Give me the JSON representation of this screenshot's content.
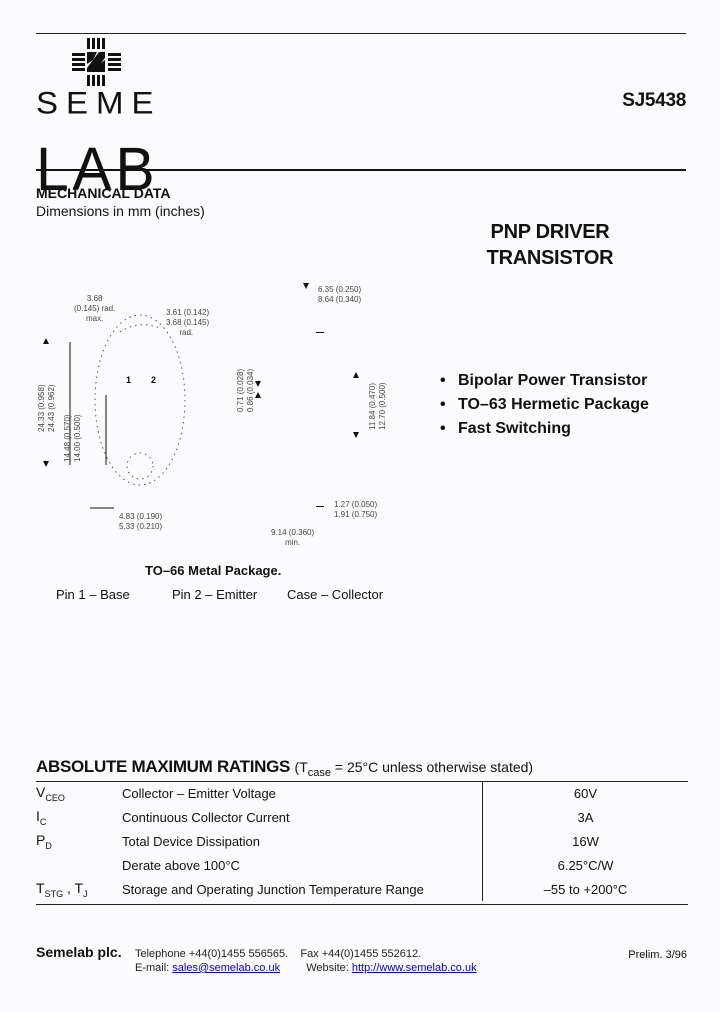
{
  "header": {
    "logo": {
      "top_text": "SEME",
      "bottom_text": "LAB",
      "icon": "semelab-cross-logo-icon"
    },
    "part_number": "SJ5438"
  },
  "mechanical": {
    "title": "MECHANICAL DATA",
    "subtitle": "Dimensions in mm (inches)",
    "dimensions": {
      "corner_radius": [
        "3.68",
        "(0.145) rad.",
        "max."
      ],
      "pin_radius": [
        "3.61 (0.142)",
        "3.68 (0.145)",
        "rad."
      ],
      "overall_height": [
        "24.33 (0.958)",
        "24.43 (0.962)"
      ],
      "pin_spacing_vert": [
        "14.48 (0.570)",
        "14.00 (0.500)"
      ],
      "pin_dia": [
        "0.71 (0.028)",
        "0.86 (0.034)"
      ],
      "cap_width": [
        "6.35 (0.250)",
        "8.64 (0.340)"
      ],
      "body_height": [
        "11.84 (0.470)",
        "12.70 (0.500)"
      ],
      "pin_offset": [
        "4.83 (0.190)",
        "5.33 (0.210)"
      ],
      "lead_length": [
        "9.14 (0.360)",
        "min."
      ],
      "flange": [
        "1.27 (0.050)",
        "1.91 (0.750)"
      ],
      "pin_labels": [
        "1",
        "2"
      ]
    },
    "package_title": "TO–66 Metal Package.",
    "pins": [
      "Pin 1 – Base",
      "Pin 2 – Emitter",
      "Case – Collector"
    ]
  },
  "product": {
    "title_line1": "PNP DRIVER",
    "title_line2": "TRANSISTOR",
    "features": [
      "Bipolar Power Transistor",
      "TO–63 Hermetic Package",
      "Fast Switching"
    ]
  },
  "ratings": {
    "title": "ABSOLUTE MAXIMUM RATINGS",
    "condition_prefix": "(T",
    "condition_sub": "case",
    "condition_suffix": " = 25°C unless otherwise stated)",
    "rows": [
      {
        "sym": "V",
        "sub": "CEO",
        "sym2": "",
        "sub2": "",
        "desc": "Collector – Emitter Voltage",
        "value": "60V"
      },
      {
        "sym": "I",
        "sub": "C",
        "sym2": "",
        "sub2": "",
        "desc": "Continuous Collector Current",
        "value": "3A"
      },
      {
        "sym": "P",
        "sub": "D",
        "sym2": "",
        "sub2": "",
        "desc": "Total Device Dissipation",
        "value": "16W"
      },
      {
        "sym": "",
        "sub": "",
        "sym2": "",
        "sub2": "",
        "desc": "Derate above 100°C",
        "value": "6.25°C/W"
      },
      {
        "sym": "T",
        "sub": "STG",
        "sym2": " , T",
        "sub2": "J",
        "desc": "Storage and Operating Junction Temperature Range",
        "value": "–55 to +200°C"
      }
    ]
  },
  "footer": {
    "company": "Semelab plc.",
    "telephone": "Telephone +44(0)1455 556565.",
    "fax": "Fax +44(0)1455 552612.",
    "email_label": "E-mail:",
    "email": "sales@semelab.co.uk",
    "website_label": "Website:",
    "website": "http://www.semelab.co.uk",
    "revision": "Prelim. 3/96"
  }
}
